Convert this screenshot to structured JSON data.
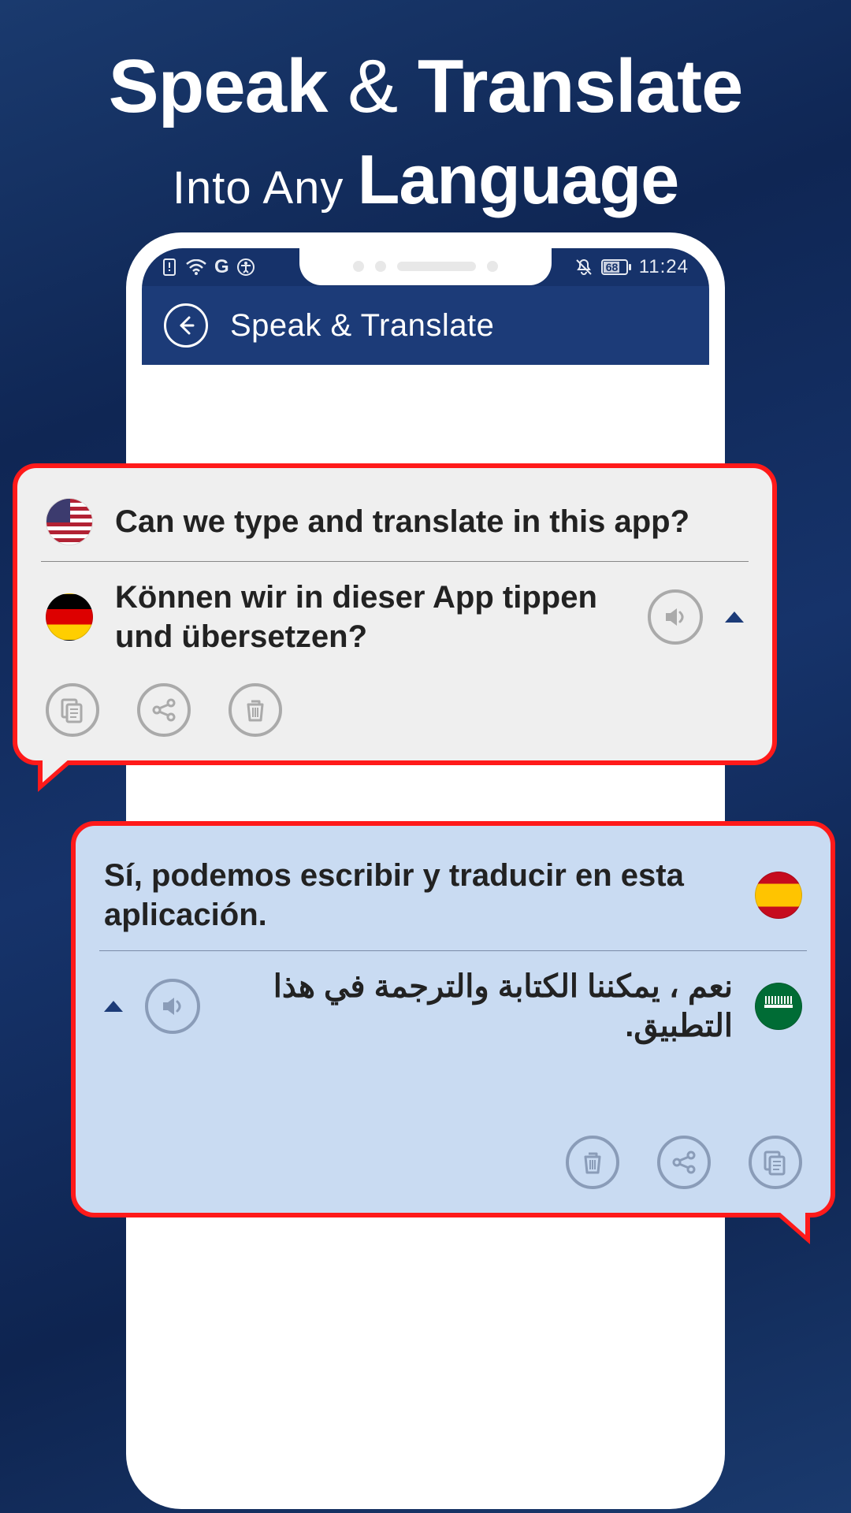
{
  "hero": {
    "speak": "Speak",
    "amp": "&",
    "translate": "Translate",
    "into_any": "Into Any",
    "language": "Language"
  },
  "statusbar": {
    "battery": "68",
    "time": "11:24"
  },
  "appbar": {
    "title": "Speak & Translate"
  },
  "card1": {
    "source_text": "Can we type and translate in this app?",
    "target_text": "Können wir in dieser App tippen und übersetzen?"
  },
  "card2": {
    "source_text": "Sí, podemos escribir y traducir en esta aplicación.",
    "target_text": "نعم ، يمكننا الكتابة والترجمة في هذا التطبيق."
  }
}
